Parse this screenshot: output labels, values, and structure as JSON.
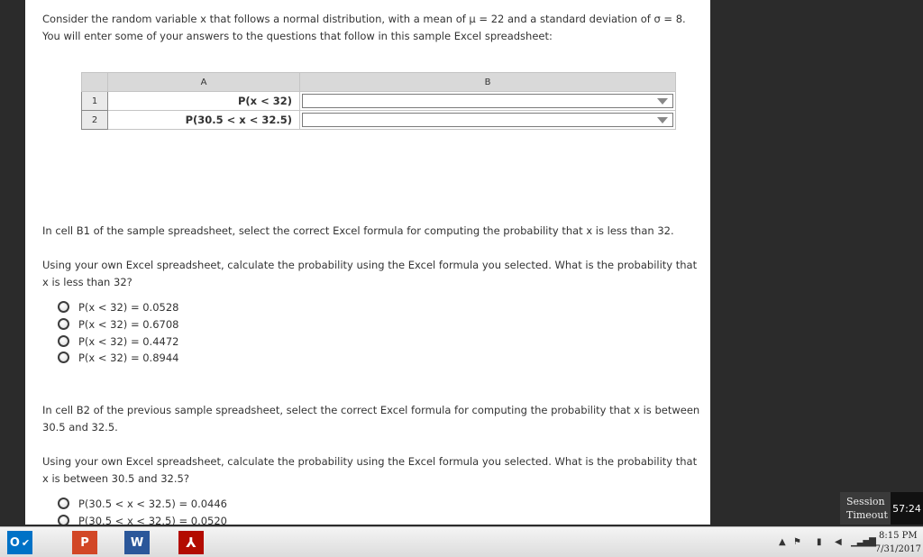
{
  "intro": "Consider the random variable x that follows a normal distribution, with a mean of μ = 22 and a standard deviation of σ = 8. You will enter some of your answers to the questions that follow in this sample Excel spreadsheet:",
  "sheet": {
    "col_a": "A",
    "col_b": "B",
    "rows": [
      {
        "num": "1",
        "label": "P(x < 32)"
      },
      {
        "num": "2",
        "label": "P(30.5 < x < 32.5)"
      }
    ]
  },
  "q1": {
    "instruction": "In cell B1 of the sample spreadsheet, select the correct Excel formula for computing the probability that x is less than 32.",
    "question": "Using your own Excel spreadsheet, calculate the probability using the Excel formula you selected. What is the probability that x is less than 32?",
    "options": [
      "P(x < 32) = 0.0528",
      "P(x < 32) = 0.6708",
      "P(x < 32) = 0.4472",
      "P(x < 32) = 0.8944"
    ]
  },
  "q2": {
    "instruction": "In cell B2 of the previous sample spreadsheet, select the correct Excel formula for computing the probability that x is between 30.5 and 32.5.",
    "question": "Using your own Excel spreadsheet, calculate the probability using the Excel formula you selected. What is the probability that x is between 30.5 and 32.5?",
    "options": [
      "P(30.5 < x < 32.5) = 0.0446",
      "P(30.5 < x < 32.5) = 0.0520"
    ]
  },
  "session": {
    "label": "Session Timeout",
    "time": "57:24"
  },
  "taskbar": {
    "apps": [
      {
        "name": "outlook-icon",
        "letter": "O",
        "color": "#0072c6"
      },
      {
        "name": "powerpoint-icon",
        "letter": "P",
        "color": "#d24726"
      },
      {
        "name": "word-icon",
        "letter": "W",
        "color": "#2b579a"
      },
      {
        "name": "acrobat-icon",
        "letter": "⅄",
        "color": "#b30b00"
      }
    ],
    "time": "8:15 PM",
    "date": "7/31/2017"
  }
}
